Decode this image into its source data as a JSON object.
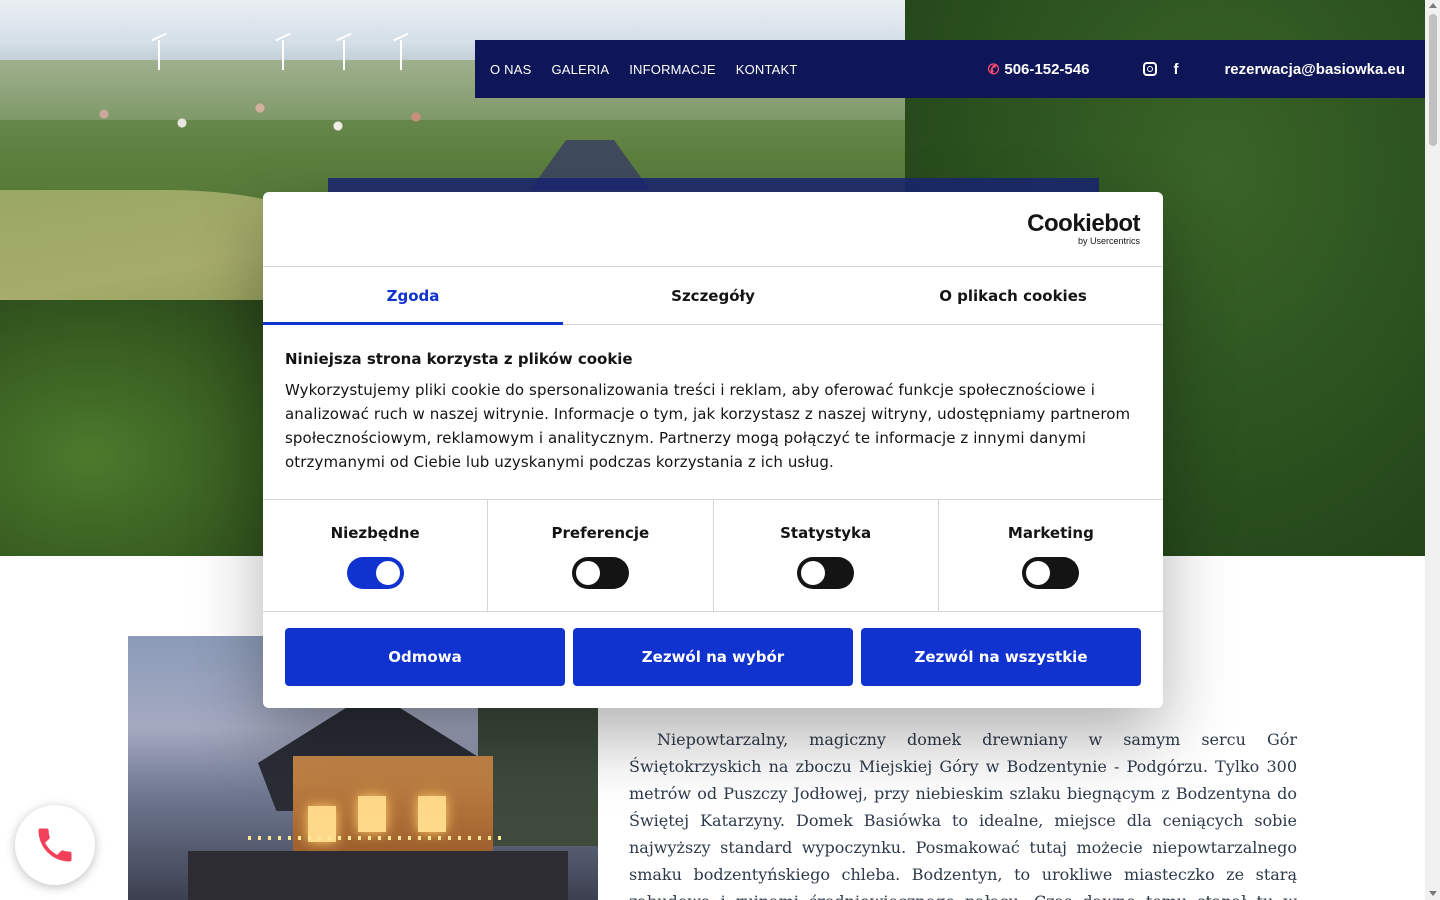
{
  "nav": {
    "links": [
      "O NAS",
      "GALERIA",
      "INFORMACJE",
      "KONTAKT"
    ],
    "phone": "506-152-546",
    "email": "rezerwacja@basiowka.eu",
    "phone_icon": "phone-icon",
    "social_icons": [
      "instagram-icon",
      "facebook-icon"
    ]
  },
  "cookie": {
    "logo_name": "Cookiebot",
    "logo_by": "by Usercentrics",
    "tabs": [
      "Zgoda",
      "Szczegóły",
      "O plikach cookies"
    ],
    "active_tab": "Zgoda",
    "heading": "Niniejsza strona korzysta z plików cookie",
    "text": "Wykorzystujemy pliki cookie do spersonalizowania treści i reklam, aby oferować funkcje społecznościowe i analizować ruch w naszej witrynie. Informacje o tym, jak korzystasz z naszej witryny, udostępniamy partnerom społecznościowym, reklamowym i analitycznym. Partnerzy mogą połączyć te informacje z innymi danymi otrzymanymi od Ciebie lub uzyskanymi podczas korzystania z ich usług.",
    "toggles": [
      {
        "label": "Niezbędne",
        "on": true
      },
      {
        "label": "Preferencje",
        "on": false
      },
      {
        "label": "Statystyka",
        "on": false
      },
      {
        "label": "Marketing",
        "on": false
      }
    ],
    "buttons": {
      "deny": "Odmowa",
      "allow_selection": "Zezwól na wybór",
      "allow_all": "Zezwól na wszystkie"
    },
    "accent_color": "#1032cf"
  },
  "intro": {
    "text": "Niepowtarzalny, magiczny domek drewniany w samym sercu Gór Świętokrzyskich na zboczu Miejskiej Góry w Bodzentynie - Podgórzu. Tylko 300 metrów od Puszczy Jodłowej, przy niebieskim szlaku biegnącym z Bodzentyna do Świętej Katarzyny. Domek Basiówka to idealne, miejsce dla ceniących sobie najwyższy standard wypoczynku. Posmakować tutaj możecie niepowtarzalnego smaku bodzentyńskiego chleba. Bodzentyn, to urokliwe miasteczko ze starą zabudową i ruinami średniowiecznego pałacu. Czas dawno temu stanął tu w leniwym miejscu..."
  },
  "colors": {
    "nav_bg": "#0f1657",
    "phone_icon_color": "#ff4d6d"
  },
  "call_button_icon": "phone-icon"
}
